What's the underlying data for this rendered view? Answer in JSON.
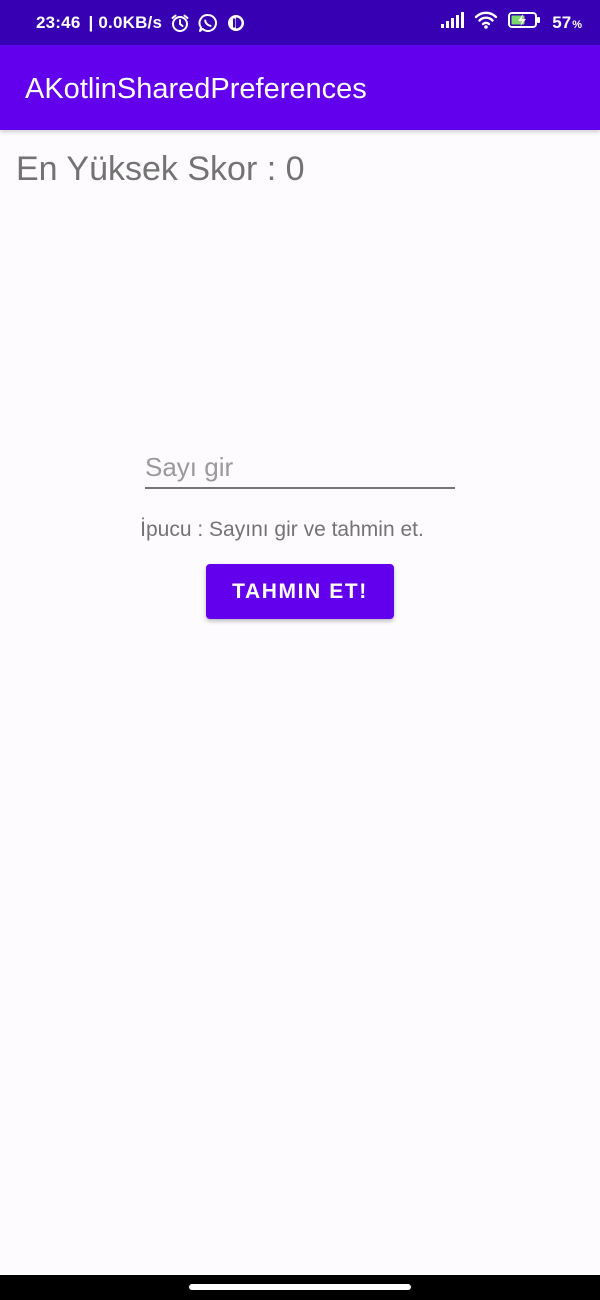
{
  "status_bar": {
    "time": "23:46",
    "net_speed": "| 0.0KB/s",
    "battery_percent": "57",
    "battery_percent_sign": "%",
    "icons": [
      "alarm-icon",
      "whatsapp-icon",
      "app-notification-icon",
      "signal-icon",
      "wifi-icon",
      "battery-charging-icon"
    ]
  },
  "app_bar": {
    "title": "AKotlinSharedPreferences",
    "color": "#6200ee"
  },
  "main": {
    "high_score": "En Yüksek Skor : 0",
    "number_input": {
      "value": "",
      "placeholder": "Sayı gir"
    },
    "hint": "İpucu : Sayını gir ve tahmin et.",
    "guess_button_label": "TAHMIN ET!"
  },
  "colors": {
    "status_bar": "#3700b3",
    "primary": "#6200ee",
    "background": "#fdfbfe",
    "text_secondary": "#737373"
  }
}
